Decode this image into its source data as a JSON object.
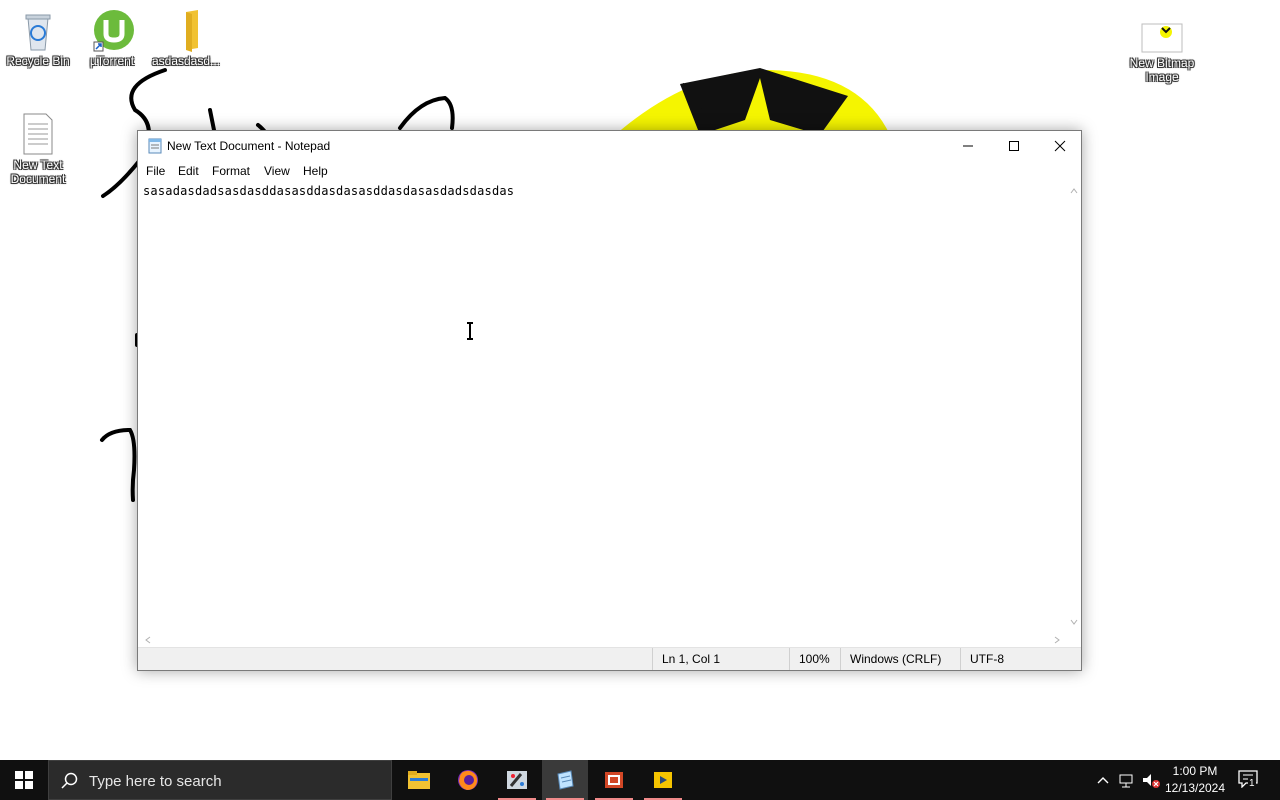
{
  "desktop": {
    "icons": [
      {
        "label": "Recycle Bin"
      },
      {
        "label": "µTorrent"
      },
      {
        "label": "asdasdasd..."
      },
      {
        "label": "New Text Document"
      },
      {
        "label": "New Bitmap Image"
      }
    ]
  },
  "notepad": {
    "title": "New Text Document - Notepad",
    "menu": [
      "File",
      "Edit",
      "Format",
      "View",
      "Help"
    ],
    "content": "sasadasdadsasdasddasasddasdasasddasdasasdadsdasdas",
    "status": {
      "position": "Ln 1, Col 1",
      "zoom": "100%",
      "line_endings": "Windows (CRLF)",
      "encoding": "UTF-8"
    }
  },
  "taskbar": {
    "search_placeholder": "Type here to search",
    "apps": [
      "file-explorer",
      "firefox",
      "paint",
      "notepad",
      "powerpoint",
      "media-player"
    ],
    "clock": {
      "time": "1:00 PM",
      "date": "12/13/2024"
    },
    "notification_count": "1"
  },
  "colors": {
    "taskbar_bg": "#101010",
    "search_bg": "#2b2b2b",
    "app_underline": "#f08a8a",
    "sun_yellow": "#f5f500"
  }
}
